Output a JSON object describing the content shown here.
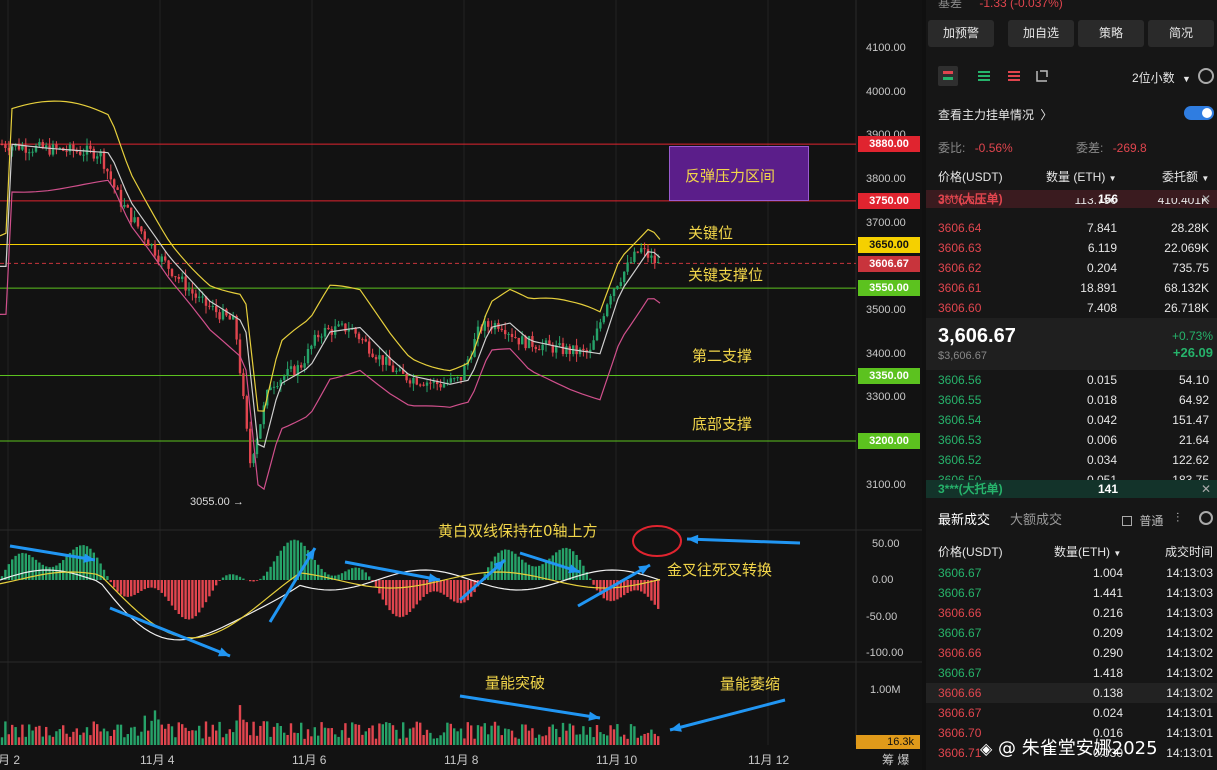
{
  "panel": {
    "top_label": "基差",
    "top_value": "-1.33 (-0.037%)",
    "buttons": [
      "加预警",
      "加自选",
      "策略",
      "简况"
    ],
    "decimals": "2位小数",
    "main_orders_label": "查看主力挂单情况",
    "ratio_label": "委比:",
    "ratio_value": "-0.56%",
    "diff_label": "委差:",
    "diff_value": "-269.8",
    "col_price": "价格(USDT)",
    "col_qty": "数量 (ETH)",
    "col_total": "委托额",
    "big_ask": {
      "label": "3***(大压单)",
      "value": "156"
    },
    "asks": [
      {
        "price": "3606.65",
        "qty": "113.790",
        "total": "410.401K"
      },
      {
        "price": "3606.64",
        "qty": "7.841",
        "total": "28.28K"
      },
      {
        "price": "3606.63",
        "qty": "6.119",
        "total": "22.069K"
      },
      {
        "price": "3606.62",
        "qty": "0.204",
        "total": "735.75"
      },
      {
        "price": "3606.61",
        "qty": "18.891",
        "total": "68.132K"
      },
      {
        "price": "3606.60",
        "qty": "7.408",
        "total": "26.718K"
      }
    ],
    "last_price": "3,606.67",
    "last_price_sub": "$3,606.67",
    "change_pct": "+0.73%",
    "change_abs": "+26.09",
    "bids": [
      {
        "price": "3606.56",
        "qty": "0.015",
        "total": "54.10"
      },
      {
        "price": "3606.55",
        "qty": "0.018",
        "total": "64.92"
      },
      {
        "price": "3606.54",
        "qty": "0.042",
        "total": "151.47"
      },
      {
        "price": "3606.53",
        "qty": "0.006",
        "total": "21.64"
      },
      {
        "price": "3606.52",
        "qty": "0.034",
        "total": "122.62"
      },
      {
        "price": "3606.50",
        "qty": "0.051",
        "total": "183.75"
      }
    ],
    "big_bid": {
      "label": "3***(大托单)",
      "value": "141"
    },
    "trade_tabs": [
      "最新成交",
      "大额成交"
    ],
    "normal_label": "普通",
    "trade_cols": [
      "价格(USDT)",
      "数量(ETH)",
      "成交时间"
    ],
    "trades": [
      {
        "price": "3606.67",
        "qty": "1.004",
        "time": "14:13:03",
        "side": "buy"
      },
      {
        "price": "3606.67",
        "qty": "1.441",
        "time": "14:13:03",
        "side": "buy"
      },
      {
        "price": "3606.66",
        "qty": "0.216",
        "time": "14:13:03",
        "side": "sell"
      },
      {
        "price": "3606.67",
        "qty": "0.209",
        "time": "14:13:02",
        "side": "buy"
      },
      {
        "price": "3606.66",
        "qty": "0.290",
        "time": "14:13:02",
        "side": "sell"
      },
      {
        "price": "3606.67",
        "qty": "1.418",
        "time": "14:13:02",
        "side": "buy"
      },
      {
        "price": "3606.66",
        "qty": "0.138",
        "time": "14:13:02",
        "side": "sell"
      },
      {
        "price": "3606.67",
        "qty": "0.024",
        "time": "14:13:01",
        "side": "sell"
      },
      {
        "price": "3606.70",
        "qty": "0.016",
        "time": "14:13:01",
        "side": "sell"
      },
      {
        "price": "3606.71",
        "qty": "0.030",
        "time": "14:13:01",
        "side": "sell"
      }
    ],
    "watermark": "@ 朱雀堂安娜2025"
  },
  "chart": {
    "price_axis": [
      "4100.00",
      "4000.00",
      "3900.00",
      "3800.00",
      "3700.00",
      "3600.00",
      "3500.00",
      "3400.00",
      "3300.00",
      "3200.00",
      "3100.00"
    ],
    "levels": [
      {
        "value": "3880.00",
        "color": "#e0242f"
      },
      {
        "value": "3750.00",
        "color": "#e0242f"
      },
      {
        "value": "3650.00",
        "color": "#f5d000"
      },
      {
        "value": "3550.00",
        "color": "#5cc21f"
      },
      {
        "value": "3350.00",
        "color": "#5cc21f"
      },
      {
        "value": "3200.00",
        "color": "#5cc21f"
      }
    ],
    "current_price": "3606.67",
    "low_label": "3055.00 →",
    "macd_axis": [
      "50.00",
      "0.00",
      "-50.00",
      "-100.00"
    ],
    "vol_axis": [
      "1.00M"
    ],
    "vol_current": "16.3k",
    "x_labels": [
      "月 2",
      "11月 4",
      "11月 6",
      "11月 8",
      "11月 10",
      "11月 12"
    ],
    "x_right": "筹 爆",
    "annotations": {
      "zone": "反弹压力区间",
      "key_level": "关键位",
      "key_support": "关键支撑位",
      "second_support": "第二支撑",
      "bottom_support": "底部支撑",
      "macd_note": "黄白双线保持在0轴上方",
      "cross_note": "金叉往死叉转换",
      "vol_break": "量能突破",
      "vol_shrink": "量能萎缩"
    },
    "colors": {
      "up": "#26a269",
      "down": "#e0454e",
      "zone_fill": "#5b1e8a"
    }
  }
}
